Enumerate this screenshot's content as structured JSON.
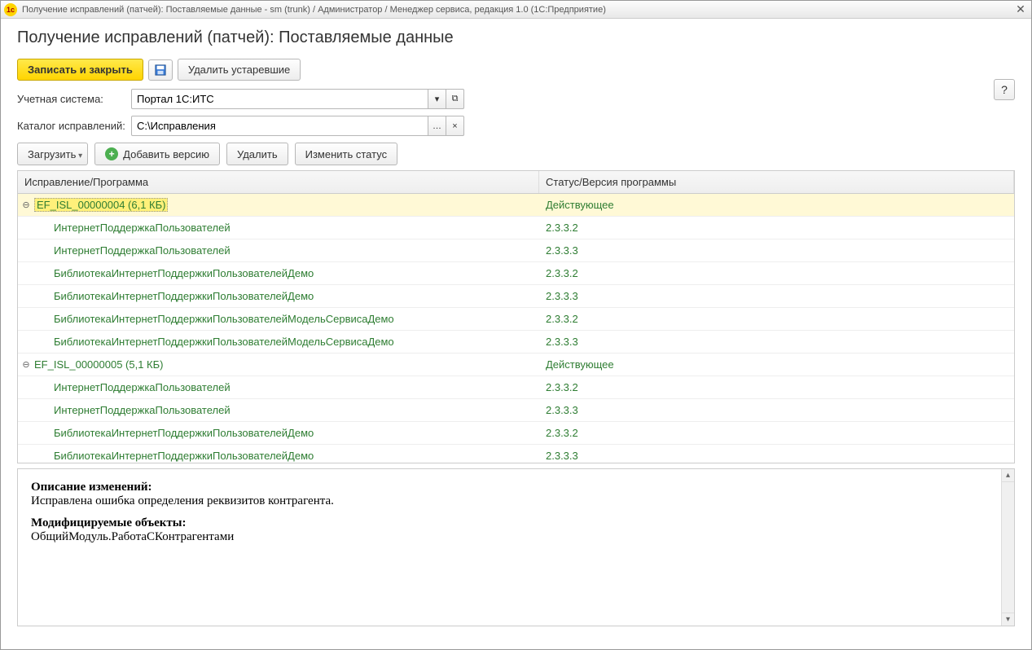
{
  "window": {
    "title": "Получение исправлений (патчей): Поставляемые данные - sm (trunk) / Администратор / Менеджер сервиса, редакция 1.0  (1С:Предприятие)",
    "app_icon_text": "1c"
  },
  "page": {
    "heading": "Получение исправлений (патчей): Поставляемые данные"
  },
  "toolbar": {
    "save_close": "Записать и закрыть",
    "delete_old": "Удалить устаревшие",
    "help": "?"
  },
  "form": {
    "account_label": "Учетная система:",
    "account_value": "Портал 1С:ИТС",
    "folder_label": "Каталог исправлений:",
    "folder_value": "C:\\Исправления"
  },
  "toolbar2": {
    "load": "Загрузить",
    "add_version": "Добавить версию",
    "delete": "Удалить",
    "change_status": "Изменить статус"
  },
  "table": {
    "col1": "Исправление/Программа",
    "col2": "Статус/Версия программы",
    "rows": [
      {
        "level": 0,
        "expander": "⊖",
        "name": "EF_ISL_00000004 (6,1 КБ)",
        "status": "Действующее",
        "selected": true
      },
      {
        "level": 1,
        "name": "ИнтернетПоддержкаПользователей",
        "status": "2.3.3.2"
      },
      {
        "level": 1,
        "name": "ИнтернетПоддержкаПользователей",
        "status": "2.3.3.3"
      },
      {
        "level": 1,
        "name": "БиблиотекаИнтернетПоддержкиПользователейДемо",
        "status": "2.3.3.2"
      },
      {
        "level": 1,
        "name": "БиблиотекаИнтернетПоддержкиПользователейДемо",
        "status": "2.3.3.3"
      },
      {
        "level": 1,
        "name": "БиблиотекаИнтернетПоддержкиПользователейМодельСервисаДемо",
        "status": "2.3.3.2"
      },
      {
        "level": 1,
        "name": "БиблиотекаИнтернетПоддержкиПользователейМодельСервисаДемо",
        "status": "2.3.3.3"
      },
      {
        "level": 0,
        "expander": "⊖",
        "name": "EF_ISL_00000005 (5,1 КБ)",
        "status": "Действующее"
      },
      {
        "level": 1,
        "name": "ИнтернетПоддержкаПользователей",
        "status": "2.3.3.2"
      },
      {
        "level": 1,
        "name": "ИнтернетПоддержкаПользователей",
        "status": "2.3.3.3"
      },
      {
        "level": 1,
        "name": "БиблиотекаИнтернетПоддержкиПользователейДемо",
        "status": "2.3.3.2"
      },
      {
        "level": 1,
        "name": "БиблиотекаИнтернетПоддержкиПользователейДемо",
        "status": "2.3.3.3"
      }
    ]
  },
  "description": {
    "heading1": "Описание изменений:",
    "text1": "Исправлена ошибка определения реквизитов контрагента.",
    "heading2": "Модифицируемые объекты:",
    "text2": "ОбщийМодуль.РаботаСКонтрагентами"
  }
}
